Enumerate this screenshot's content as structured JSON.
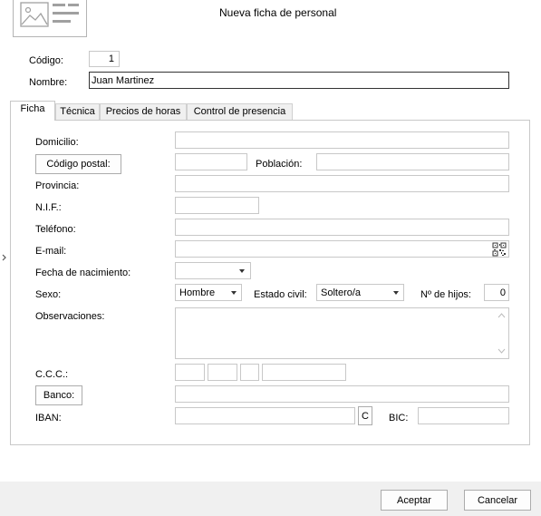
{
  "window": {
    "title": "Nueva ficha de personal"
  },
  "header": {
    "codigo_label": "Código:",
    "codigo_value": "1",
    "nombre_label": "Nombre:",
    "nombre_value": "Juan Martinez"
  },
  "tabs": [
    {
      "label": "Ficha",
      "active": true
    },
    {
      "label": "Técnica",
      "active": false
    },
    {
      "label": "Precios de horas",
      "active": false
    },
    {
      "label": "Control de presencia",
      "active": false
    }
  ],
  "form": {
    "domicilio_label": "Domicilio:",
    "codigo_postal_button": "Código postal:",
    "poblacion_label": "Población:",
    "provincia_label": "Provincia:",
    "nif_label": "N.I.F.:",
    "telefono_label": "Teléfono:",
    "email_label": "E-mail:",
    "fecha_nacimiento_label": "Fecha de nacimiento:",
    "sexo_label": "Sexo:",
    "sexo_value": "Hombre",
    "estado_civil_label": "Estado civil:",
    "estado_civil_value": "Soltero/a",
    "num_hijos_label": "Nº de hijos:",
    "num_hijos_value": "0",
    "observaciones_label": "Observaciones:",
    "ccc_label": "C.C.C.:",
    "banco_button": "Banco:",
    "iban_label": "IBAN:",
    "iban_c_button": "C",
    "bic_label": "BIC:"
  },
  "footer": {
    "accept_button": "Aceptar",
    "cancel_button": "Cancelar"
  },
  "colors": {
    "field_border": "#c8c8c8",
    "button_border": "#acacac",
    "footer_bg": "#f0f0f0"
  }
}
